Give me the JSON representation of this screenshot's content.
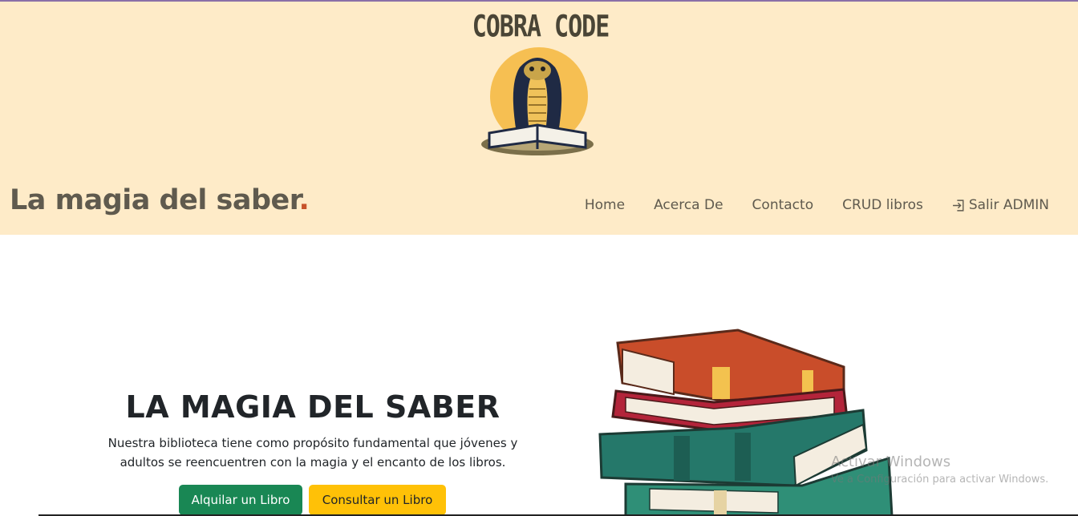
{
  "header": {
    "logo_text": "COBRA CODE",
    "brand_text": "La magia del saber",
    "brand_dot": "."
  },
  "nav": {
    "items": [
      {
        "label": "Home"
      },
      {
        "label": "Acerca De"
      },
      {
        "label": "Contacto"
      },
      {
        "label": "CRUD libros"
      },
      {
        "label": "Salir ADMIN",
        "icon": "logout-icon"
      }
    ]
  },
  "hero": {
    "title": "LA MAGIA DEL SABER",
    "text_line1": "Nuestra biblioteca tiene como propósito fundamental que jóvenes y",
    "text_line2": "adultos se reencuentren con la magia y el encanto de los libros.",
    "btn_rent": "Alquilar un Libro",
    "btn_check": "Consultar un Libro"
  },
  "watermark": {
    "line1": "Activar Windows",
    "line2": "Ve a Configuración para activar Windows."
  },
  "colors": {
    "header_bg": "#feebc8",
    "accent_dot": "#c7522a",
    "btn_success": "#198754",
    "btn_warning": "#ffc107"
  }
}
